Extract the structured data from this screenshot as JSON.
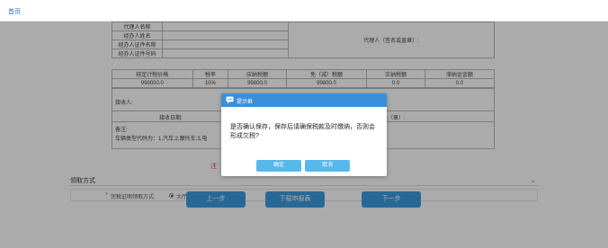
{
  "nav": {
    "home": "首页"
  },
  "agent_table": {
    "rows": [
      {
        "label": "代理人名称"
      },
      {
        "label": "经办人姓名"
      },
      {
        "label": "经办人证件名称"
      },
      {
        "label": "经办人证件号码"
      }
    ],
    "signature_label": "代理人（签名或盖章）:"
  },
  "tax_table": {
    "headers": [
      "核定计税价格",
      "税率",
      "应纳税额",
      "免（减）税额",
      "实纳税额",
      "滞纳金金额"
    ],
    "values": [
      "998000.0",
      "10%",
      "99800.0",
      "99800.0",
      "0.0",
      "0.0"
    ]
  },
  "taxbox": {
    "recv_label": "接收人:",
    "date_label": "接收日期:",
    "seal_label": "关（章）:",
    "remark_label": "备注:",
    "vehicle_code": "车辆类型代码为：1,汽车;2,摩托车;3,电"
  },
  "warning_partial": "注",
  "collection": {
    "title": "领取方式",
    "required_mark": "*",
    "field_label": "完税证明领取方式:",
    "option": "大厅领取"
  },
  "buttons": {
    "prev": "上一步",
    "download": "下载申报表",
    "next": "下一步"
  },
  "dialog": {
    "title": "提示框",
    "message": "是否确认保存，保存后请确保税款及时缴纳，否则会形成欠税?",
    "ok": "确定",
    "cancel": "取消"
  },
  "colors": {
    "accent": "#3a8fd8",
    "dialog_button": "#57b8ea",
    "required": "#e33333"
  }
}
